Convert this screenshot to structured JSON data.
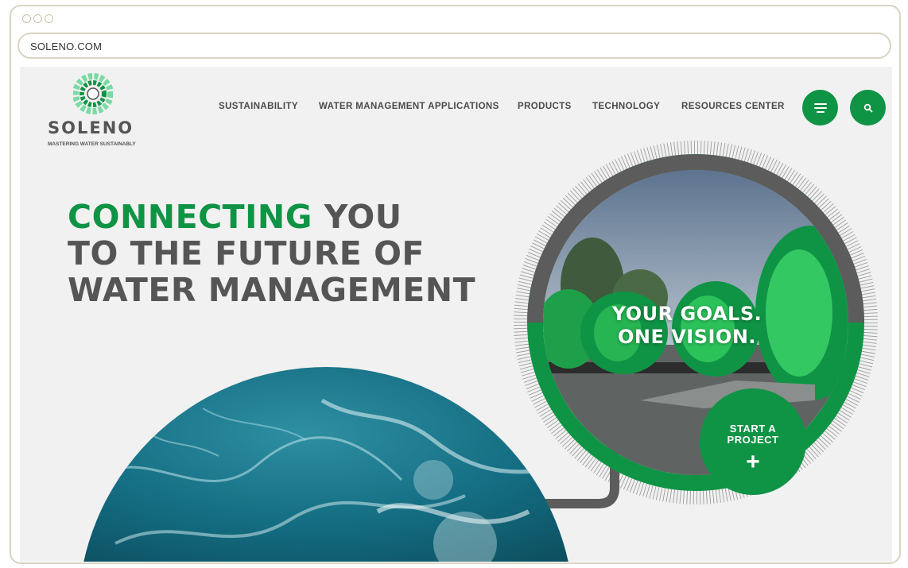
{
  "browser": {
    "url": "SOLENO.COM"
  },
  "logo": {
    "word": "SOLENO",
    "tagline": "MASTERING WATER SUSTAINABLY"
  },
  "nav": {
    "items": [
      {
        "label": "SUSTAINABILITY"
      },
      {
        "label": "WATER MANAGEMENT APPLICATIONS"
      },
      {
        "label": "PRODUCTS"
      },
      {
        "label": "TECHNOLOGY"
      },
      {
        "label": "RESOURCES CENTER"
      }
    ],
    "menu_icon": "hamburger-icon",
    "search_icon": "search-icon"
  },
  "hero": {
    "headline_accent": "CONNECTING",
    "headline_rest_1": " YOU",
    "headline_line_2": "TO THE FUTURE OF",
    "headline_line_3": "WATER MANAGEMENT",
    "circle_text_1": "YOUR GOALS.",
    "circle_text_2": "ONE VISION.",
    "cta_line_1": "START A",
    "cta_line_2": "PROJECT",
    "cta_icon": "plus-icon"
  },
  "colors": {
    "brand_green": "#0f9445",
    "text_gray": "#555555",
    "page_bg": "#f1f1f1"
  }
}
